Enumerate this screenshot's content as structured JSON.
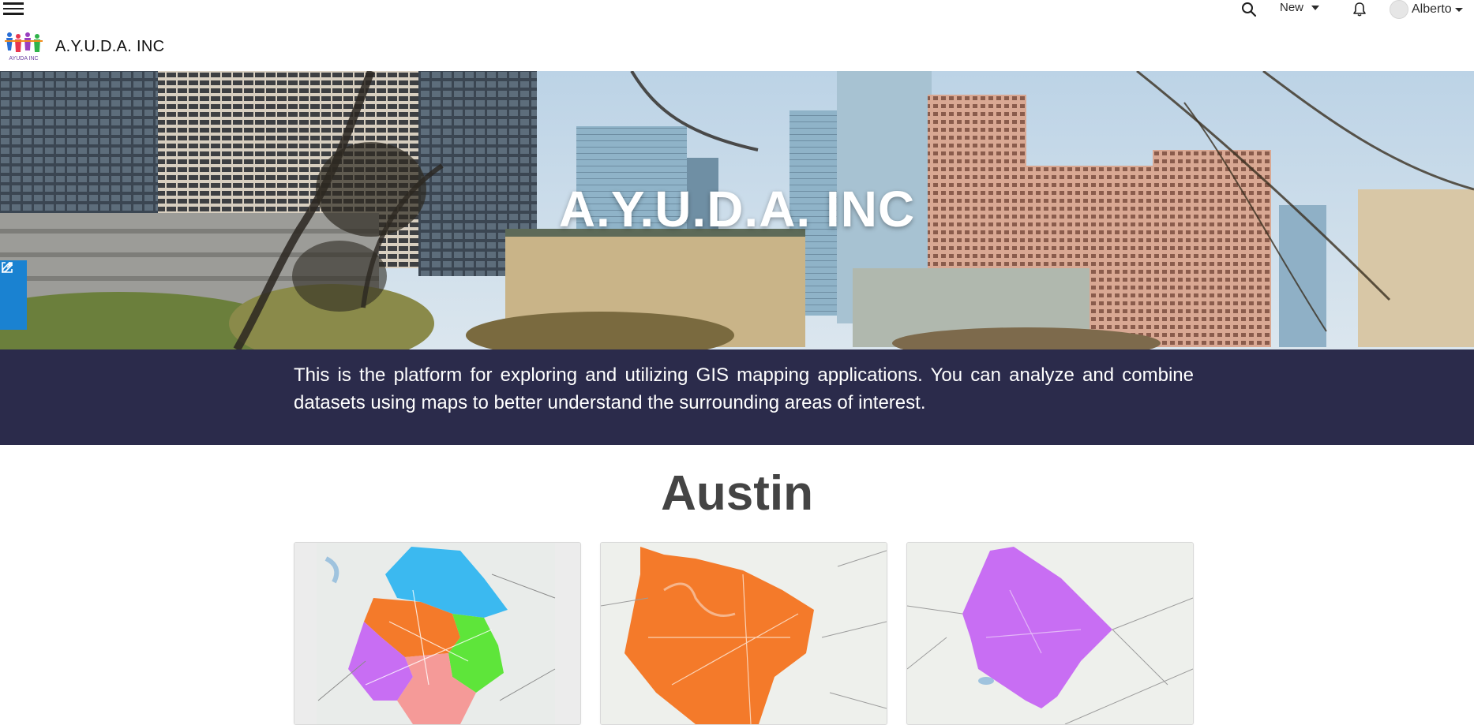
{
  "header": {
    "menu_icon": "hamburger-menu-icon",
    "search_icon": "search-icon",
    "new_label": "New",
    "notifications_icon": "bell-icon",
    "user_name": "Alberto",
    "brand_title": "A.Y.U.D.A. INC",
    "logo_text": "AYUDA INC"
  },
  "hero": {
    "title": "A.Y.U.D.A. INC",
    "tools": [
      "pencil-icon",
      "share-icon"
    ]
  },
  "intro": {
    "text": "This is the platform for exploring and utilizing GIS mapping applications. You can analyze and combine datasets using maps to better understand the surrounding areas of interest."
  },
  "section": {
    "title": "Austin"
  },
  "cards": [
    {
      "name": "map-card-1",
      "description": "multi-district colored map"
    },
    {
      "name": "map-card-2",
      "description": "orange county map"
    },
    {
      "name": "map-card-3",
      "description": "purple county map"
    }
  ],
  "colors": {
    "intro_bg": "#2b2b4b",
    "side_tools_bg": "#1a82d1",
    "map_blue": "#3bb9f0",
    "map_orange": "#f47a2a",
    "map_green": "#5ee53a",
    "map_purple": "#c86ef3",
    "map_pink": "#f59a98"
  }
}
